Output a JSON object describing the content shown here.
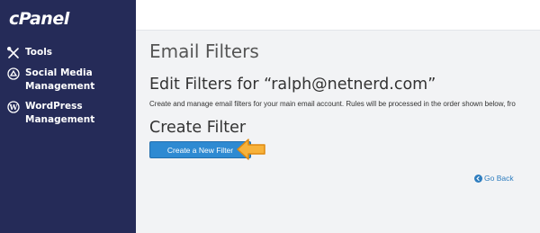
{
  "sidebar": {
    "logo": "cPanel",
    "items": [
      {
        "label_line1": "Tools",
        "label_line2": "",
        "icon": "tools-icon"
      },
      {
        "label_line1": "Social Media",
        "label_line2": "Management",
        "icon": "social-media-icon"
      },
      {
        "label_line1": "WordPress",
        "label_line2": "Management",
        "icon": "wordpress-icon"
      }
    ]
  },
  "main": {
    "page_title": "Email Filters",
    "edit_title": "Edit Filters for “ralph@netnerd.com”",
    "description": "Create and manage email filters for your main email account. Rules will be processed in the order shown below, fro",
    "create_title": "Create Filter",
    "create_button": "Create a New Filter",
    "go_back": "Go Back"
  },
  "colors": {
    "sidebar_bg": "#252b58",
    "button_bg": "#2e8ad2",
    "link": "#2e7dbf",
    "arrow": "#f5a623"
  }
}
